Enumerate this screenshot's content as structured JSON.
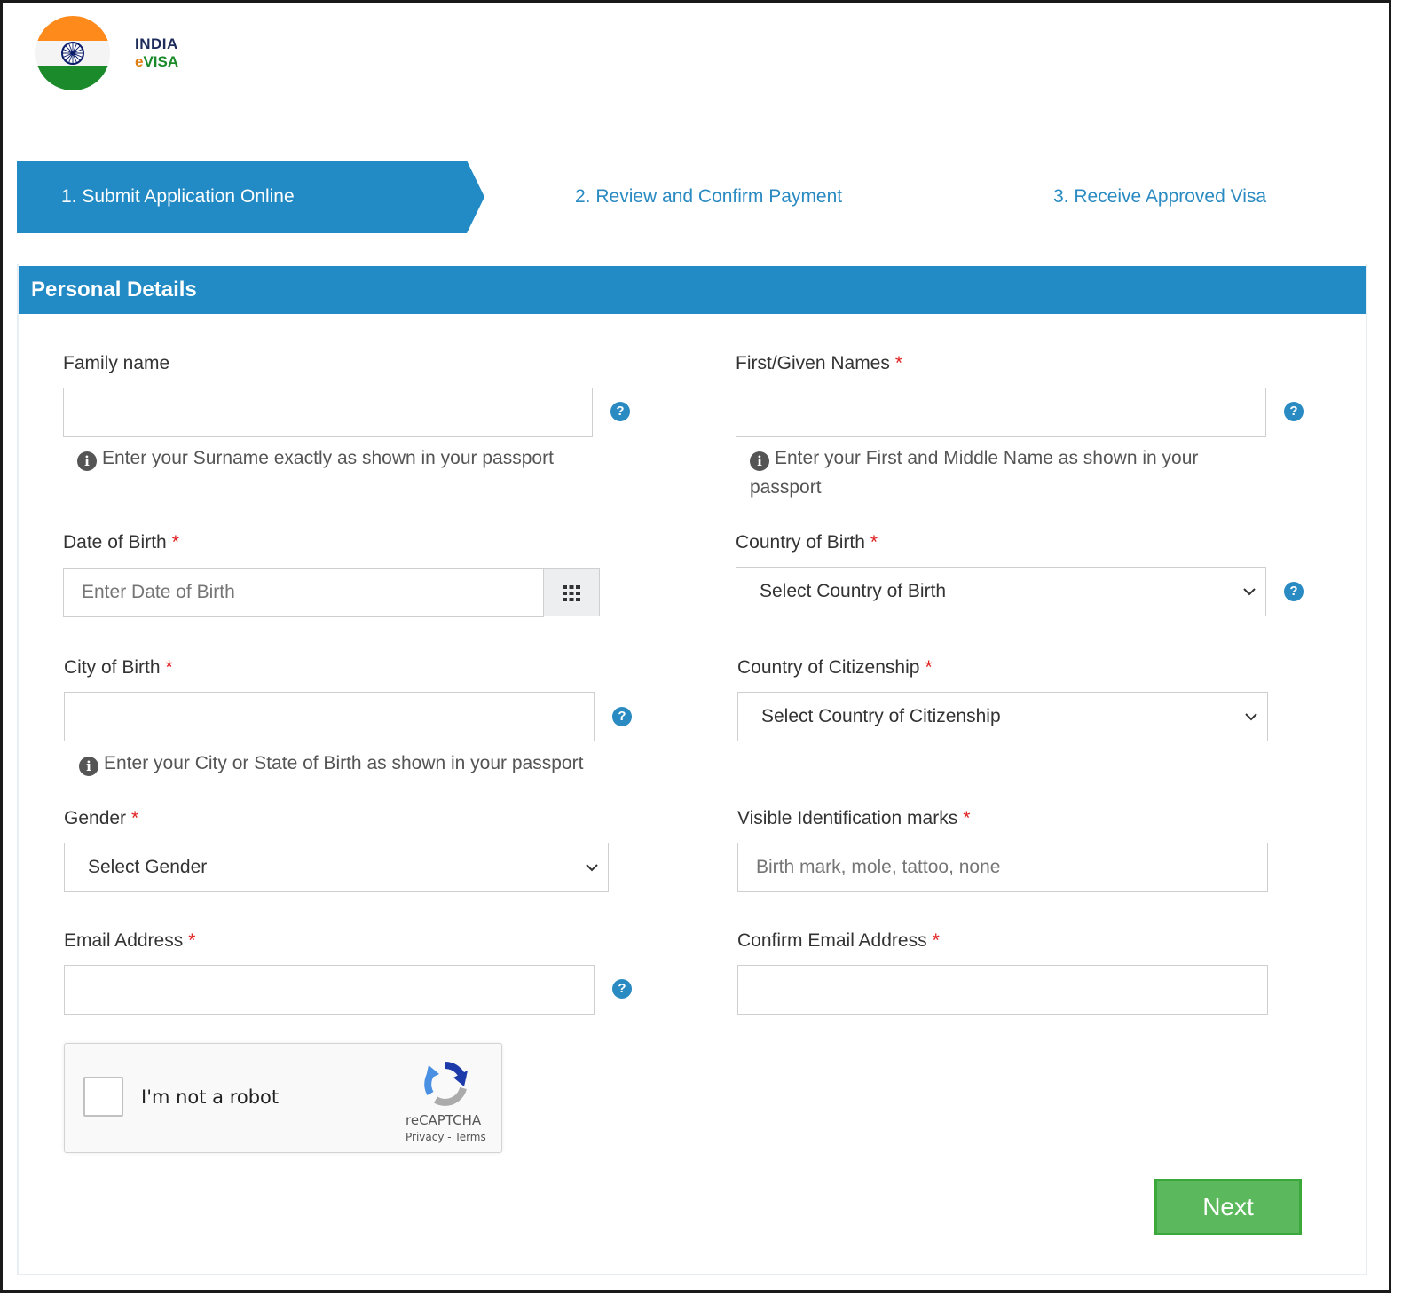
{
  "brand": {
    "line1": "INDIA",
    "line2_prefix": "e",
    "line2_rest": "VISA"
  },
  "steps": [
    {
      "label": "1. Submit Application Online",
      "active": true
    },
    {
      "label": "2. Review and Confirm Payment",
      "active": false
    },
    {
      "label": "3. Receive Approved Visa",
      "active": false
    }
  ],
  "section_title": "Personal Details",
  "required_mark": "*",
  "help_glyph": "?",
  "info_glyph": "i",
  "fields": {
    "family_name": {
      "label": "Family name",
      "value": "",
      "hint": "Enter your Surname exactly as shown in your passport"
    },
    "given_names": {
      "label": "First/Given Names",
      "value": "",
      "hint": "Enter your First and Middle Name as shown in your passport"
    },
    "dob": {
      "label": "Date of Birth",
      "placeholder": "Enter Date of Birth"
    },
    "country_birth": {
      "label": "Country of Birth",
      "selected": "Select Country of Birth"
    },
    "city_birth": {
      "label": "City of Birth",
      "value": "",
      "hint": "Enter your City or State of Birth as shown in your passport"
    },
    "citizenship": {
      "label": "Country of Citizenship",
      "selected": "Select Country of Citizenship"
    },
    "gender": {
      "label": "Gender",
      "selected": "Select Gender"
    },
    "marks": {
      "label": "Visible Identification marks",
      "placeholder": "Birth mark, mole, tattoo, none"
    },
    "email": {
      "label": "Email Address",
      "value": ""
    },
    "confirm_email": {
      "label": "Confirm Email Address",
      "value": ""
    }
  },
  "captcha": {
    "label": "I'm not a robot",
    "brand": "reCAPTCHA",
    "links": "Privacy - Terms"
  },
  "next_button": "Next",
  "colors": {
    "primary": "#228ac4",
    "success": "#5cb85c",
    "required": "#e02020"
  },
  "icons": [
    "help-icon",
    "info-icon",
    "calendar-grid-icon",
    "chevron-down-icon",
    "recaptcha-icon",
    "india-flag-logo"
  ]
}
